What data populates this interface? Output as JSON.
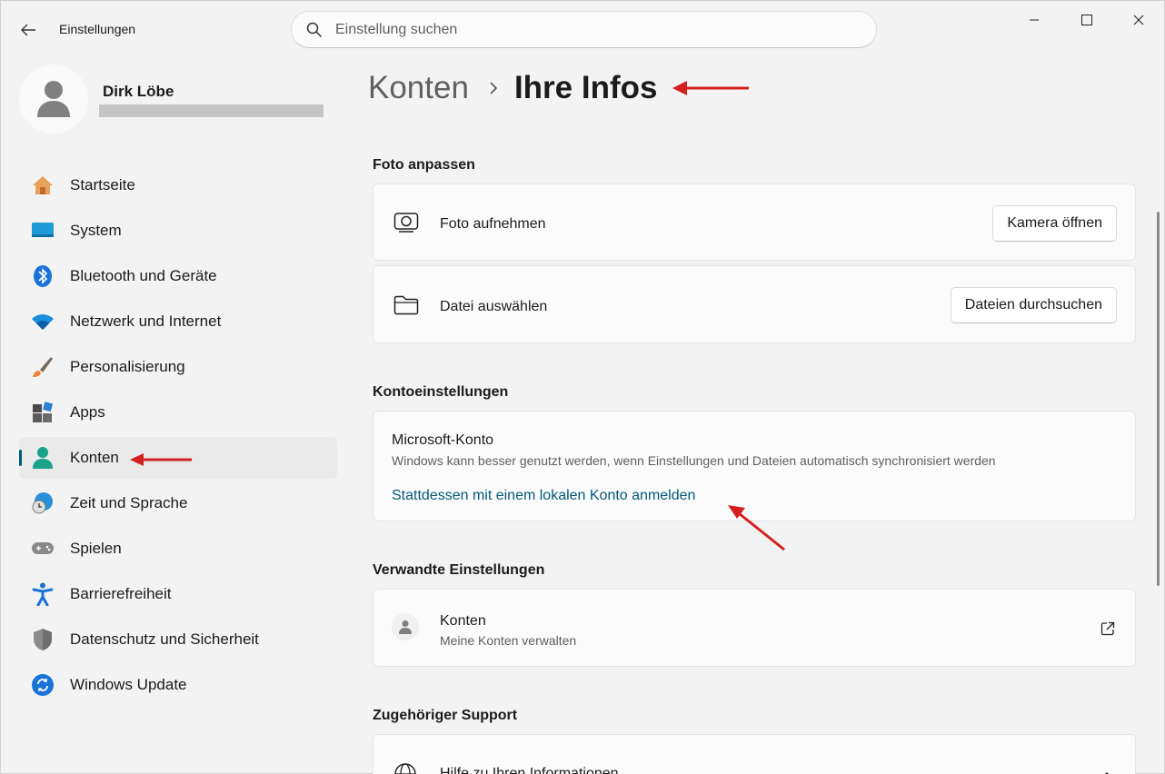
{
  "app": {
    "title": "Einstellungen"
  },
  "search": {
    "placeholder": "Einstellung suchen"
  },
  "user": {
    "name": "Dirk Löbe"
  },
  "nav": {
    "items": [
      {
        "label": "Startseite",
        "icon": "home-icon"
      },
      {
        "label": "System",
        "icon": "system-icon"
      },
      {
        "label": "Bluetooth und Geräte",
        "icon": "bluetooth-icon"
      },
      {
        "label": "Netzwerk und Internet",
        "icon": "wifi-icon"
      },
      {
        "label": "Personalisierung",
        "icon": "brush-icon"
      },
      {
        "label": "Apps",
        "icon": "apps-icon"
      },
      {
        "label": "Konten",
        "icon": "account-icon",
        "active": true
      },
      {
        "label": "Zeit und Sprache",
        "icon": "clock-globe-icon"
      },
      {
        "label": "Spielen",
        "icon": "gamepad-icon"
      },
      {
        "label": "Barrierefreiheit",
        "icon": "accessibility-icon"
      },
      {
        "label": "Datenschutz und Sicherheit",
        "icon": "shield-icon"
      },
      {
        "label": "Windows Update",
        "icon": "update-icon"
      }
    ]
  },
  "breadcrumb": {
    "parent": "Konten",
    "current": "Ihre Infos"
  },
  "photo": {
    "section_title": "Foto anpassen",
    "take_photo": {
      "label": "Foto aufnehmen",
      "button": "Kamera öffnen"
    },
    "choose_file": {
      "label": "Datei auswählen",
      "button": "Dateien durchsuchen"
    }
  },
  "account_settings": {
    "section_title": "Kontoeinstellungen",
    "title": "Microsoft-Konto",
    "description": "Windows kann besser genutzt werden, wenn Einstellungen und Dateien automatisch synchronisiert werden",
    "link": "Stattdessen mit einem lokalen Konto anmelden"
  },
  "related": {
    "section_title": "Verwandte Einstellungen",
    "title": "Konten",
    "subtitle": "Meine Konten verwalten"
  },
  "support": {
    "section_title": "Zugehöriger Support",
    "item": "Hilfe zu Ihren Informationen"
  },
  "colors": {
    "accent": "#005a7a",
    "annotation": "#d42020",
    "background": "#f3f3f3",
    "card": "#fbfbfb"
  }
}
